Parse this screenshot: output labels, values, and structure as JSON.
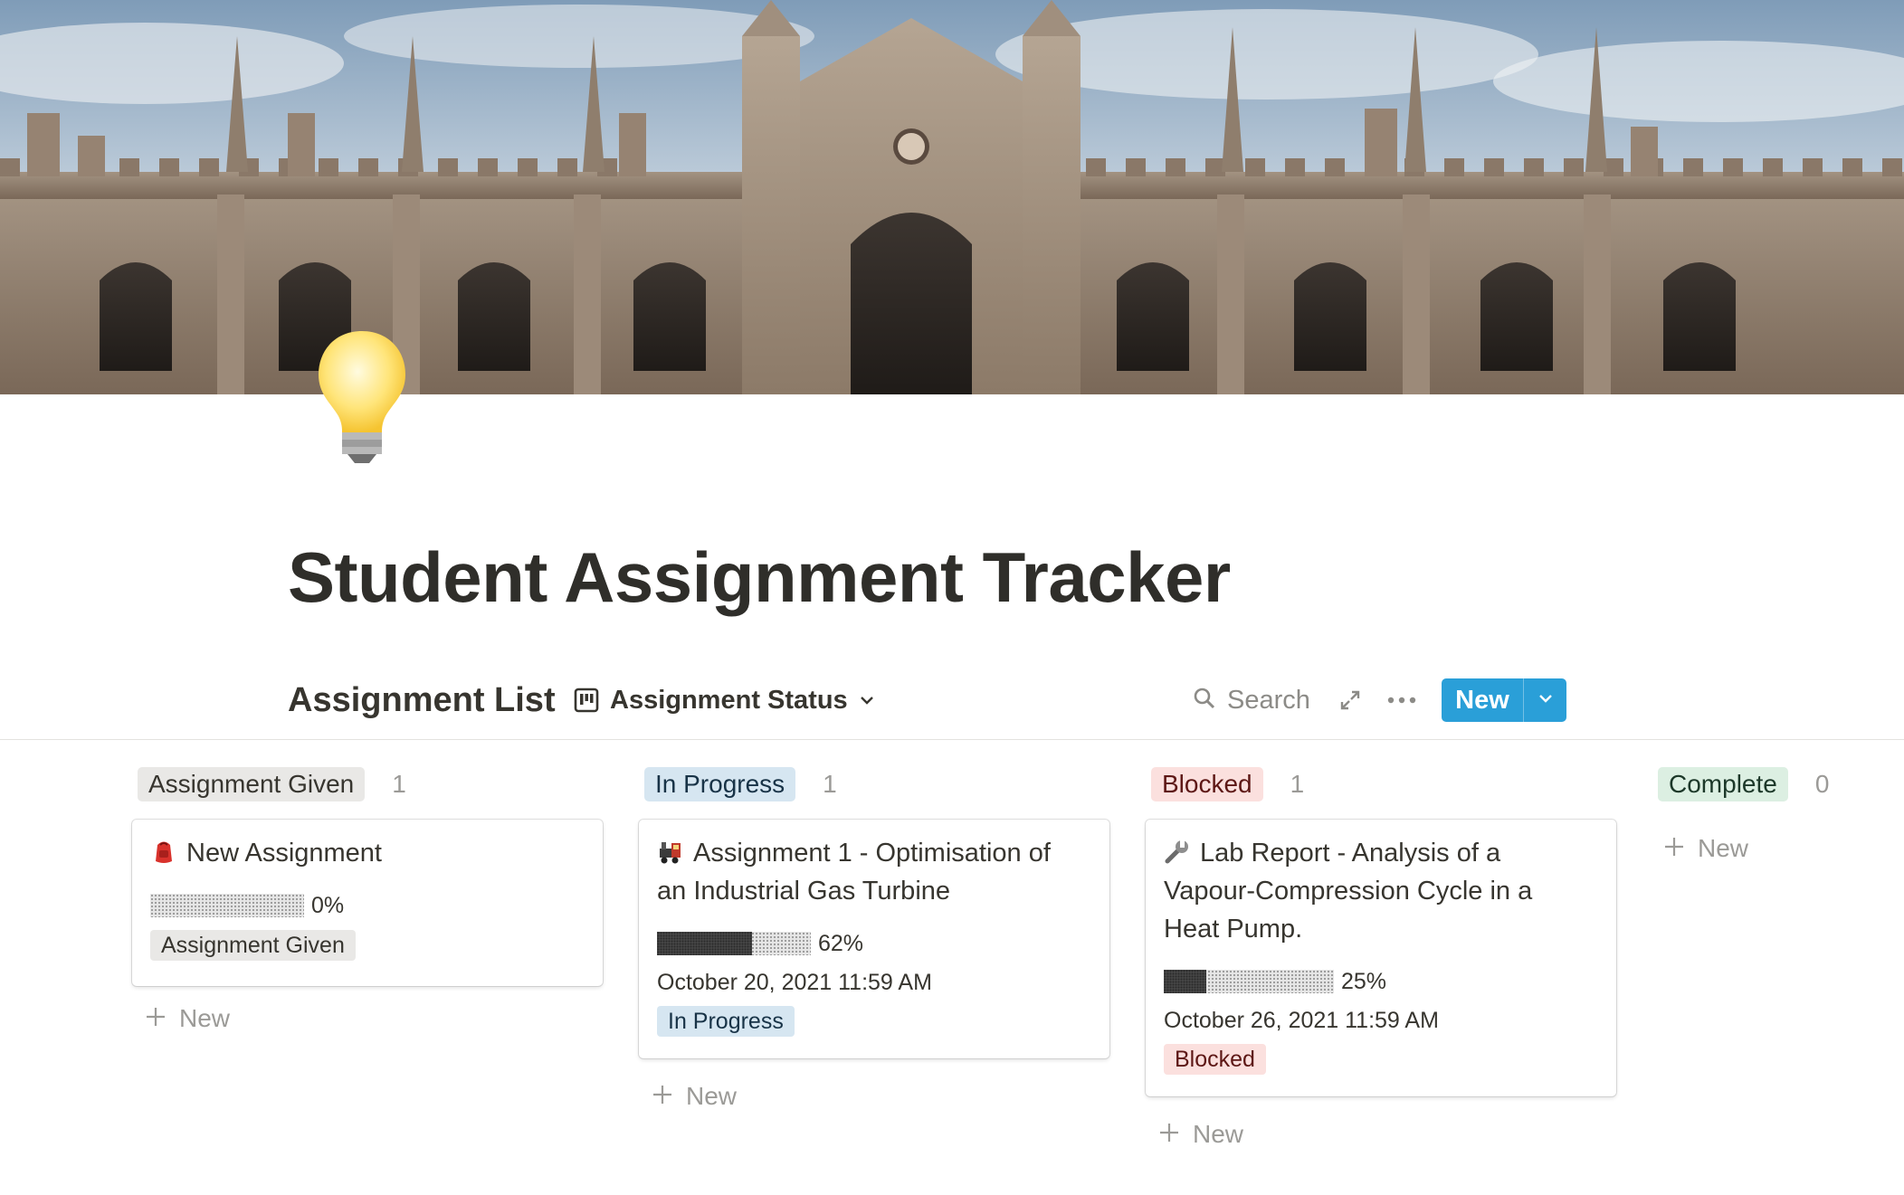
{
  "page": {
    "title": "Student Assignment Tracker"
  },
  "database": {
    "title": "Assignment List",
    "view_label": "Assignment Status",
    "search_label": "Search",
    "new_label": "New"
  },
  "columns": [
    {
      "label": "Assignment Given",
      "count": "1",
      "color": "#e9e8e6",
      "add_label": "New",
      "cards": [
        {
          "emoji": "backpack-icon",
          "title": "New Assignment",
          "progress": 0,
          "progress_label": "0%",
          "date": "",
          "status": "Assignment Given"
        }
      ]
    },
    {
      "label": "In Progress",
      "count": "1",
      "color": "#d6e6f1",
      "add_label": "New",
      "cards": [
        {
          "emoji": "locomotive-icon",
          "title": "Assignment 1 - Optimisation of an Industrial Gas Turbine",
          "progress": 0.62,
          "progress_label": "62%",
          "date": "October 20, 2021 11:59 AM",
          "status": "In Progress"
        }
      ]
    },
    {
      "label": "Blocked",
      "count": "1",
      "color": "#fbe0de",
      "add_label": "New",
      "cards": [
        {
          "emoji": "wrench-icon",
          "title": "Lab Report - Analysis of a Vapour-Compression Cycle in a Heat Pump.",
          "progress": 0.25,
          "progress_label": "25%",
          "date": "October 26, 2021 11:59 AM",
          "status": "Blocked"
        }
      ]
    },
    {
      "label": "Complete",
      "count": "0",
      "color": "#dcefe2",
      "add_label": "New",
      "cards": []
    }
  ],
  "theme": {
    "accent": "#2a9fd8",
    "text": "#37352f"
  }
}
